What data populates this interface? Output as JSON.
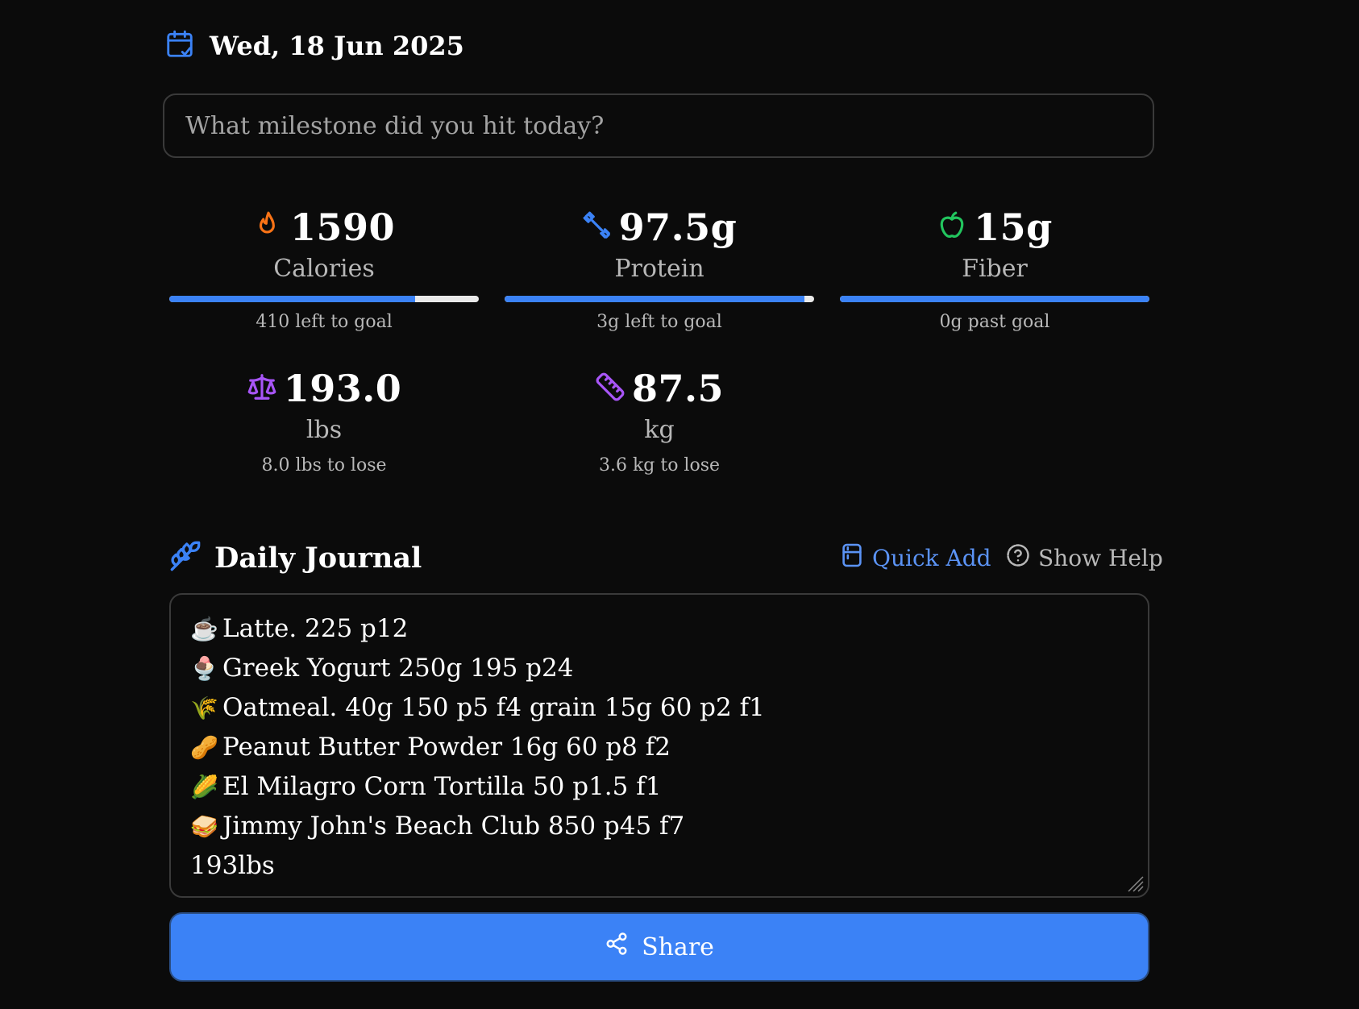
{
  "header": {
    "date": "Wed, 18 Jun 2025"
  },
  "milestone": {
    "placeholder": "What milestone did you hit today?"
  },
  "stats": {
    "calories": {
      "value": "1590",
      "label": "Calories",
      "sub": "410 left to goal",
      "progress": 0.795,
      "icon": "flame-icon",
      "color": "#f97316"
    },
    "protein": {
      "value": "97.5g",
      "label": "Protein",
      "sub": "3g left to goal",
      "progress": 0.97,
      "icon": "dumbbell-icon",
      "color": "#3b82f6"
    },
    "fiber": {
      "value": "15g",
      "label": "Fiber",
      "sub": "0g past goal",
      "progress": 1.0,
      "icon": "apple-icon",
      "color": "#22c55e"
    },
    "weight_lbs": {
      "value": "193.0",
      "label": "lbs",
      "sub": "8.0 lbs to lose",
      "icon": "scale-icon",
      "color": "#a855f7"
    },
    "weight_kg": {
      "value": "87.5",
      "label": "kg",
      "sub": "3.6 kg to lose",
      "icon": "ruler-icon",
      "color": "#a855f7"
    }
  },
  "journal": {
    "title": "Daily Journal",
    "quick_add": "Quick Add",
    "show_help": "Show Help",
    "lines": [
      {
        "emoji": "☕",
        "text": "Latte. 225 p12"
      },
      {
        "emoji": "🍨",
        "text": "Greek Yogurt 250g 195 p24"
      },
      {
        "emoji": "🌾",
        "text": "Oatmeal. 40g 150 p5 f4 grain 15g 60 p2 f1"
      },
      {
        "emoji": "🥜",
        "text": "Peanut Butter Powder 16g 60 p8 f2"
      },
      {
        "emoji": "🌽",
        "text": "El Milagro Corn Tortilla 50 p1.5 f1"
      },
      {
        "emoji": "🥪",
        "text": "Jimmy John's Beach Club 850 p45 f7"
      },
      {
        "emoji": "",
        "text": "193lbs"
      }
    ]
  },
  "share": {
    "label": "Share"
  },
  "colors": {
    "accent": "#3b82f6",
    "background": "#0b0b0b",
    "muted_text": "#b8b8b8",
    "border": "#3a3a3a"
  }
}
